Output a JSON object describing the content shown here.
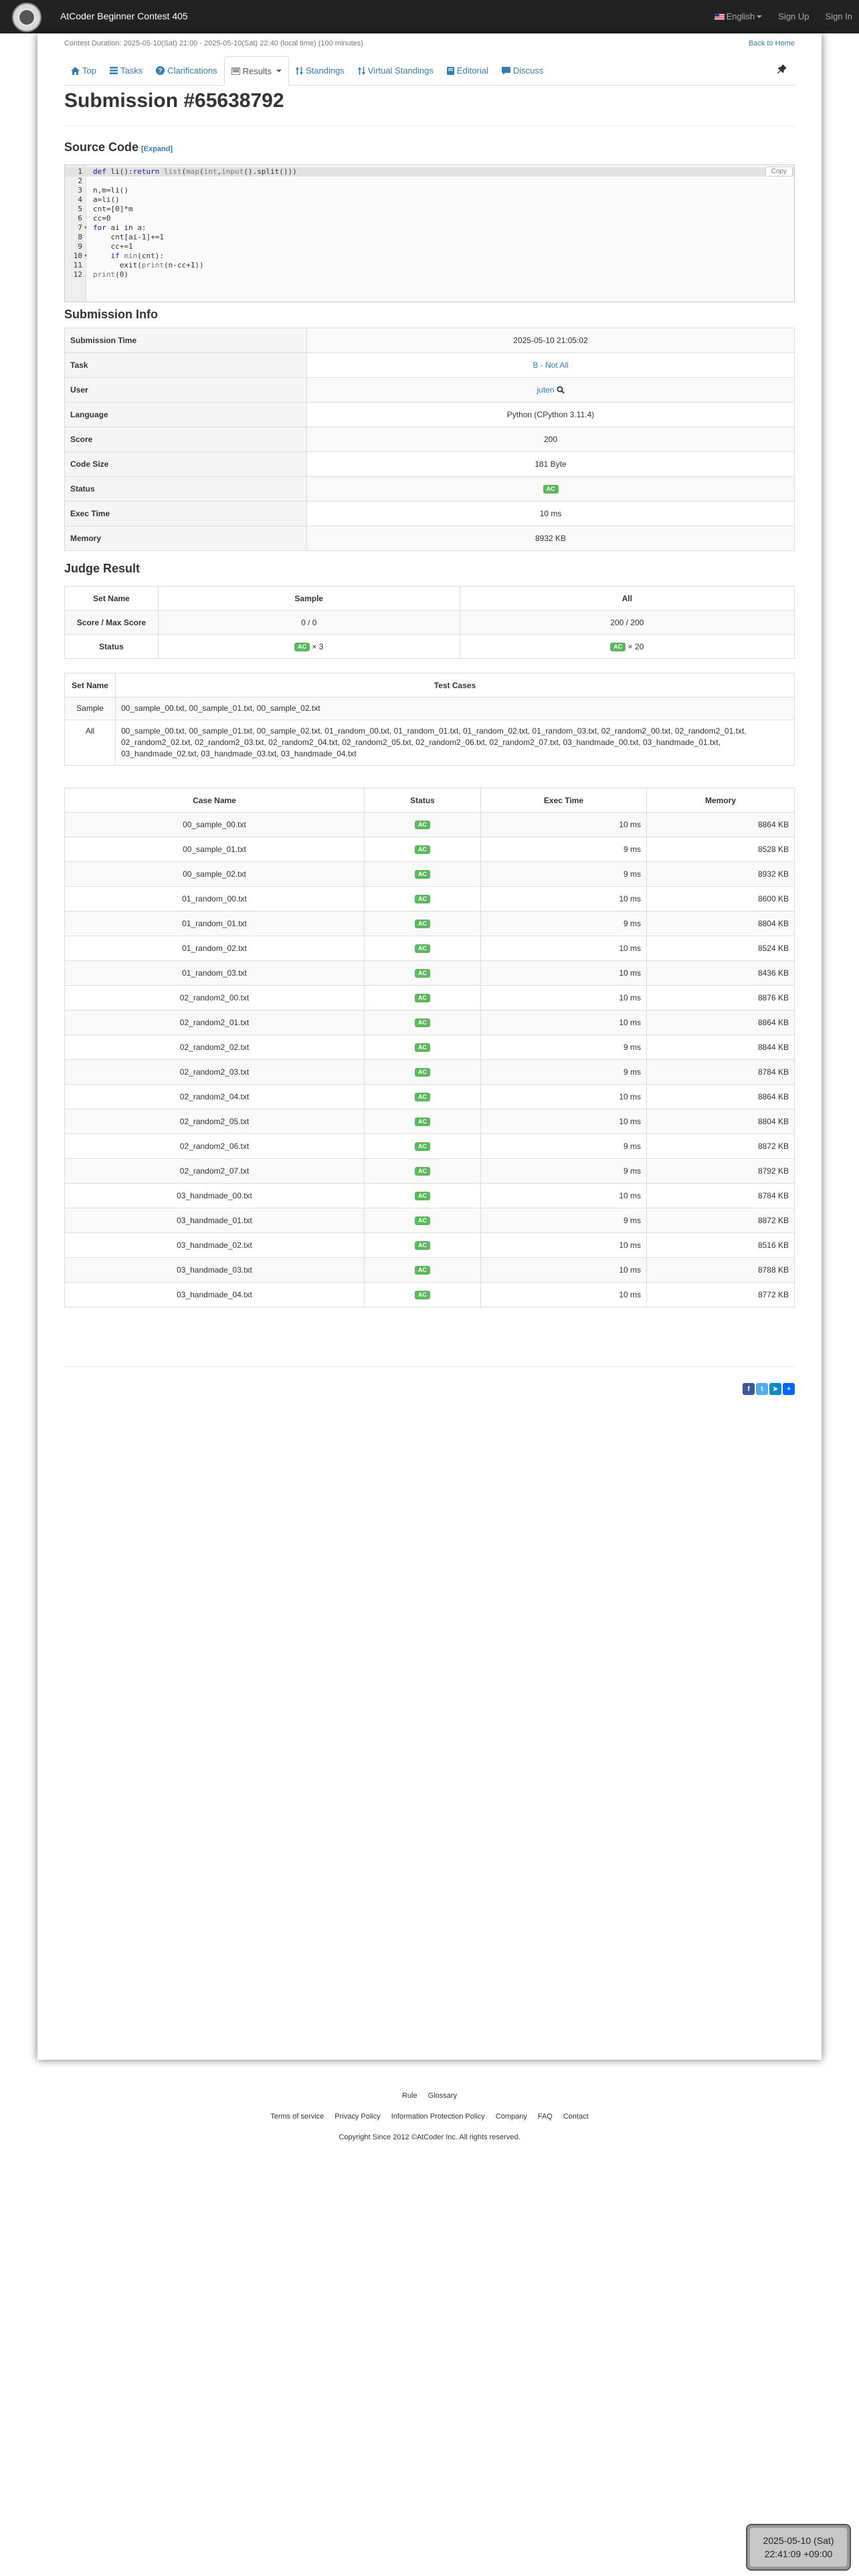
{
  "header": {
    "contest_name": "AtCoder Beginner Contest 405",
    "language": "English",
    "sign_up": "Sign Up",
    "sign_in": "Sign In"
  },
  "contest": {
    "duration": "Contest Duration: 2025-05-10(Sat) 21:00 - 2025-05-10(Sat) 22:40 (local time) (100 minutes)",
    "back_home": "Back to Home"
  },
  "tabs": {
    "top": "Top",
    "tasks": "Tasks",
    "clarifications": "Clarifications",
    "results": "Results",
    "standings": "Standings",
    "virtual_standings": "Virtual Standings",
    "editorial": "Editorial",
    "discuss": "Discuss"
  },
  "page_title": "Submission #65638792",
  "source": {
    "heading": "Source Code",
    "expand": "[Expand]",
    "copy": "Copy",
    "lines": [
      "def li():return list(map(int,input().split()))",
      "",
      "n,m=li()",
      "a=li()",
      "cnt=[0]*m",
      "cc=0",
      "for ai in a:",
      "    cnt[ai-1]+=1",
      "    cc+=1",
      "    if min(cnt):",
      "      exit(print(n-cc+1))",
      "print(0)"
    ]
  },
  "info": {
    "heading": "Submission Info",
    "rows": [
      {
        "label": "Submission Time",
        "value": "2025-05-10 21:05:02"
      },
      {
        "label": "Task",
        "value": "B - Not All"
      },
      {
        "label": "User",
        "value": "juten"
      },
      {
        "label": "Language",
        "value": "Python (CPython 3.11.4)"
      },
      {
        "label": "Score",
        "value": "200"
      },
      {
        "label": "Code Size",
        "value": "181 Byte"
      },
      {
        "label": "Status",
        "value": "AC"
      },
      {
        "label": "Exec Time",
        "value": "10 ms"
      },
      {
        "label": "Memory",
        "value": "8932 KB"
      }
    ]
  },
  "judge": {
    "heading": "Judge Result",
    "col_set": "Set Name",
    "col_sample": "Sample",
    "col_all": "All",
    "score_label": "Score / Max Score",
    "sample_score": "0 / 0",
    "all_score": "200 / 200",
    "status_label": "Status",
    "sample_status": "AC",
    "sample_count": "× 3",
    "all_status": "AC",
    "all_count": "× 20"
  },
  "sets": {
    "col_set": "Set Name",
    "col_cases": "Test Cases",
    "rows": [
      {
        "name": "Sample",
        "cases": "00_sample_00.txt, 00_sample_01.txt, 00_sample_02.txt"
      },
      {
        "name": "All",
        "cases": "00_sample_00.txt, 00_sample_01.txt, 00_sample_02.txt, 01_random_00.txt, 01_random_01.txt, 01_random_02.txt, 01_random_03.txt, 02_random2_00.txt, 02_random2_01.txt, 02_random2_02.txt, 02_random2_03.txt, 02_random2_04.txt, 02_random2_05.txt, 02_random2_06.txt, 02_random2_07.txt, 03_handmade_00.txt, 03_handmade_01.txt, 03_handmade_02.txt, 03_handmade_03.txt, 03_handmade_04.txt"
      }
    ]
  },
  "cases": {
    "col_name": "Case Name",
    "col_status": "Status",
    "col_time": "Exec Time",
    "col_memory": "Memory",
    "rows": [
      {
        "name": "00_sample_00.txt",
        "status": "AC",
        "time": "10 ms",
        "memory": "8864 KB"
      },
      {
        "name": "00_sample_01.txt",
        "status": "AC",
        "time": "9 ms",
        "memory": "8528 KB"
      },
      {
        "name": "00_sample_02.txt",
        "status": "AC",
        "time": "9 ms",
        "memory": "8932 KB"
      },
      {
        "name": "01_random_00.txt",
        "status": "AC",
        "time": "10 ms",
        "memory": "8600 KB"
      },
      {
        "name": "01_random_01.txt",
        "status": "AC",
        "time": "9 ms",
        "memory": "8804 KB"
      },
      {
        "name": "01_random_02.txt",
        "status": "AC",
        "time": "10 ms",
        "memory": "8524 KB"
      },
      {
        "name": "01_random_03.txt",
        "status": "AC",
        "time": "10 ms",
        "memory": "8436 KB"
      },
      {
        "name": "02_random2_00.txt",
        "status": "AC",
        "time": "10 ms",
        "memory": "8876 KB"
      },
      {
        "name": "02_random2_01.txt",
        "status": "AC",
        "time": "10 ms",
        "memory": "8864 KB"
      },
      {
        "name": "02_random2_02.txt",
        "status": "AC",
        "time": "9 ms",
        "memory": "8844 KB"
      },
      {
        "name": "02_random2_03.txt",
        "status": "AC",
        "time": "9 ms",
        "memory": "8784 KB"
      },
      {
        "name": "02_random2_04.txt",
        "status": "AC",
        "time": "10 ms",
        "memory": "8864 KB"
      },
      {
        "name": "02_random2_05.txt",
        "status": "AC",
        "time": "10 ms",
        "memory": "8804 KB"
      },
      {
        "name": "02_random2_06.txt",
        "status": "AC",
        "time": "9 ms",
        "memory": "8872 KB"
      },
      {
        "name": "02_random2_07.txt",
        "status": "AC",
        "time": "9 ms",
        "memory": "8792 KB"
      },
      {
        "name": "03_handmade_00.txt",
        "status": "AC",
        "time": "10 ms",
        "memory": "8784 KB"
      },
      {
        "name": "03_handmade_01.txt",
        "status": "AC",
        "time": "9 ms",
        "memory": "8872 KB"
      },
      {
        "name": "03_handmade_02.txt",
        "status": "AC",
        "time": "10 ms",
        "memory": "8516 KB"
      },
      {
        "name": "03_handmade_03.txt",
        "status": "AC",
        "time": "10 ms",
        "memory": "8788 KB"
      },
      {
        "name": "03_handmade_04.txt",
        "status": "AC",
        "time": "10 ms",
        "memory": "8772 KB"
      }
    ]
  },
  "footer": {
    "row1": [
      "Rule",
      "Glossary"
    ],
    "row2": [
      "Terms of service",
      "Privacy Policy",
      "Information Protection Policy",
      "Company",
      "FAQ",
      "Contact"
    ],
    "copyright": "Copyright Since 2012 ©AtCoder Inc. All rights reserved."
  },
  "clock": {
    "date": "2025-05-10 (Sat)",
    "time": "22:41:09 +09:00"
  },
  "colors": {
    "navbar": "#222222",
    "link": "#337ab7",
    "ac": "#5cb85c"
  }
}
